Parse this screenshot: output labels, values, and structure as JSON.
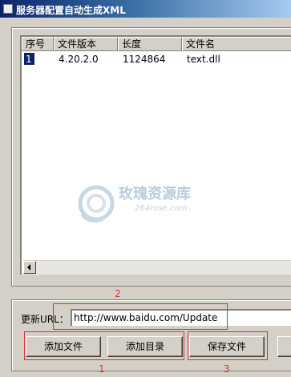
{
  "window": {
    "title": "服务器配置自动生成XML"
  },
  "file_list": {
    "columns": [
      "序号",
      "文件版本",
      "长度",
      "文件名"
    ],
    "rows": [
      {
        "index": "1",
        "version": "4.20.2.0",
        "length": "1124864",
        "name": "text.dll"
      }
    ]
  },
  "url": {
    "label": "更新URL：",
    "value": "http://www.baidu.com/Update"
  },
  "buttons": {
    "add_file": "添加文件",
    "add_dir": "添加目录",
    "save_file": "保存文件"
  },
  "annotations": {
    "box1": "1",
    "box2": "2",
    "box3": "3"
  },
  "watermark": {
    "title": "玫瑰资源库",
    "subtitle": "264rose.com"
  },
  "colors": {
    "title_start": "#0a246a",
    "title_end": "#a6caf0",
    "annotation_red": "#e03030",
    "selection": "#0a246a"
  }
}
